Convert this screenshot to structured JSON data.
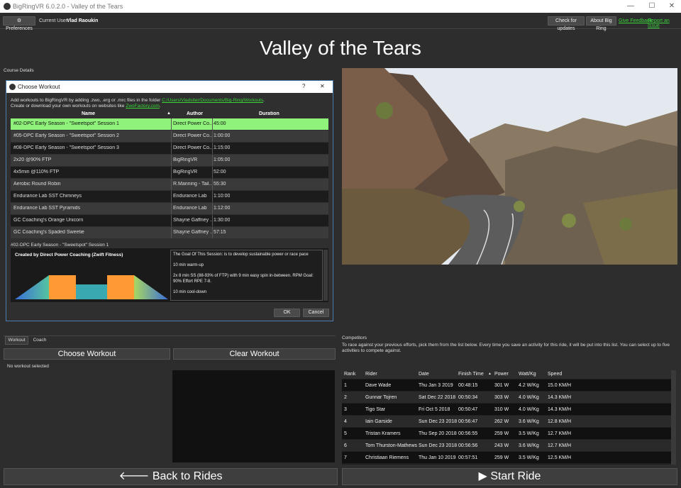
{
  "window": {
    "title": "BigRingVR 6.0.2.0 - Valley of the Tears"
  },
  "topbar": {
    "preferences": "Preferences",
    "current_user_label": "Current User:",
    "current_user": "Vlad Raoukin",
    "check_updates": "Check for updates",
    "about": "About Big Ring",
    "give_feedback": "Give Feedback",
    "report_issue": "Report an Issue"
  },
  "page": {
    "title": "Valley of the Tears",
    "course_details": "Course Details"
  },
  "dialog": {
    "title": "Choose Workout",
    "help": "?",
    "close": "✕",
    "info_line1": "Add workouts to BigRingVR by adding .zwo, .erg or .mrc files in the folder",
    "info_path": "C:/Users/Vladsiter/Documents/Big-Ring/Workouts",
    "info_line2": "Create or download your own workouts on websites like",
    "info_site": "ZwoFactory.com",
    "columns": [
      "Name",
      "Author",
      "Duration"
    ],
    "rows": [
      {
        "name": "#02-DPC Early Season - \"Sweetspot\" Session 1",
        "author": "Direct Power Co...",
        "duration": "45:00"
      },
      {
        "name": "#05-DPC Early Season - \"Sweetspot\" Session 2",
        "author": "Direct Power Co...",
        "duration": "1:00:00"
      },
      {
        "name": "#08-DPC Early Season - \"Sweetspot\" Session 3",
        "author": "Direct Power Co...",
        "duration": "1:15:00"
      },
      {
        "name": "2x20 @90% FTP",
        "author": "BigRingVR",
        "duration": "1:05:00"
      },
      {
        "name": "4x5min @110% FTP",
        "author": "BigRingVR",
        "duration": "52:00"
      },
      {
        "name": "Aerobic Round Robin",
        "author": "R.Manning - Tail...",
        "duration": "55:30"
      },
      {
        "name": "Endurance Lab SST Chimneys",
        "author": "Endurance Lab",
        "duration": "1:10:00"
      },
      {
        "name": "Endurance Lab SST Pyramids",
        "author": "Endurance Lab",
        "duration": "1:12:00"
      },
      {
        "name": "GC Coaching's Orange Unicorn",
        "author": "Shayne Gaffney ...",
        "duration": "1:30:00"
      },
      {
        "name": "GC Coaching's Spaded Sweetie",
        "author": "Shayne Gaffney ...",
        "duration": "57:15"
      }
    ],
    "selected_name": "#02-DPC Early Season - \"Sweetspot\" Session 1",
    "created_by": "Created by Direct Power Coaching (Zwift Fitness)",
    "description": [
      "The Goal Of This Session: is to develop sustainable power or race pace",
      "10 min warm-up",
      "2x 8 min SS (88-93% of FTP) with 9 min easy spin in-between. RPM Goal: 90% Effort RPE 7-8.",
      "10 min cool-down"
    ],
    "ok": "OK",
    "cancel": "Cancel"
  },
  "workout_panel": {
    "tabs": [
      "Workout",
      "Coach"
    ],
    "choose": "Choose Workout",
    "clear": "Clear Workout",
    "status": "No workout selected"
  },
  "competitors": {
    "title": "Competitors",
    "info": "To race against your previous efforts, pick them from the list below. Every time you save an activity for this ride, it will be put into this list. You can select up to five activities to compete against.",
    "columns": [
      "Rank",
      "Rider",
      "Date",
      "Finish Time",
      "Power",
      "Watt/Kg",
      "Speed"
    ],
    "rows": [
      {
        "rank": "1",
        "rider": "Dave Wade",
        "date": "Thu Jan 3 2019",
        "time": "00:48:15",
        "power": "301 W",
        "wkg": "4.2 W/Kg",
        "speed": "15.0 KM/H"
      },
      {
        "rank": "2",
        "rider": "Gunnar Tojren",
        "date": "Sat Dec 22 2018",
        "time": "00:50:34",
        "power": "303 W",
        "wkg": "4.0 W/Kg",
        "speed": "14.3 KM/H"
      },
      {
        "rank": "3",
        "rider": "Tigo Star",
        "date": "Fri Oct 5 2018",
        "time": "00:50:47",
        "power": "310 W",
        "wkg": "4.0 W/Kg",
        "speed": "14.3 KM/H"
      },
      {
        "rank": "4",
        "rider": "Iain Garside",
        "date": "Sun Dec 23 2018",
        "time": "00:56:47",
        "power": "262 W",
        "wkg": "3.6 W/Kg",
        "speed": "12.8 KM/H"
      },
      {
        "rank": "5",
        "rider": "Tristan Kramers",
        "date": "Thu Sep 20 2018",
        "time": "00:56:55",
        "power": "259 W",
        "wkg": "3.5 W/Kg",
        "speed": "12.7 KM/H"
      },
      {
        "rank": "6",
        "rider": "Tom Thurston-Mathews",
        "date": "Sun Dec 23 2018",
        "time": "00:56:56",
        "power": "243 W",
        "wkg": "3.6 W/Kg",
        "speed": "12.7 KM/H"
      },
      {
        "rank": "7",
        "rider": "Christiaan Riemens",
        "date": "Thu Jan 10 2019",
        "time": "00:57:51",
        "power": "259 W",
        "wkg": "3.5 W/Kg",
        "speed": "12.5 KM/H"
      }
    ]
  },
  "footer": {
    "back": "Back to Rides",
    "start": "Start Ride"
  },
  "colors": {
    "selected_row": "#8ff27a",
    "link": "#39d439",
    "interval": "#ff9933",
    "rest": "#3aa8b0"
  }
}
